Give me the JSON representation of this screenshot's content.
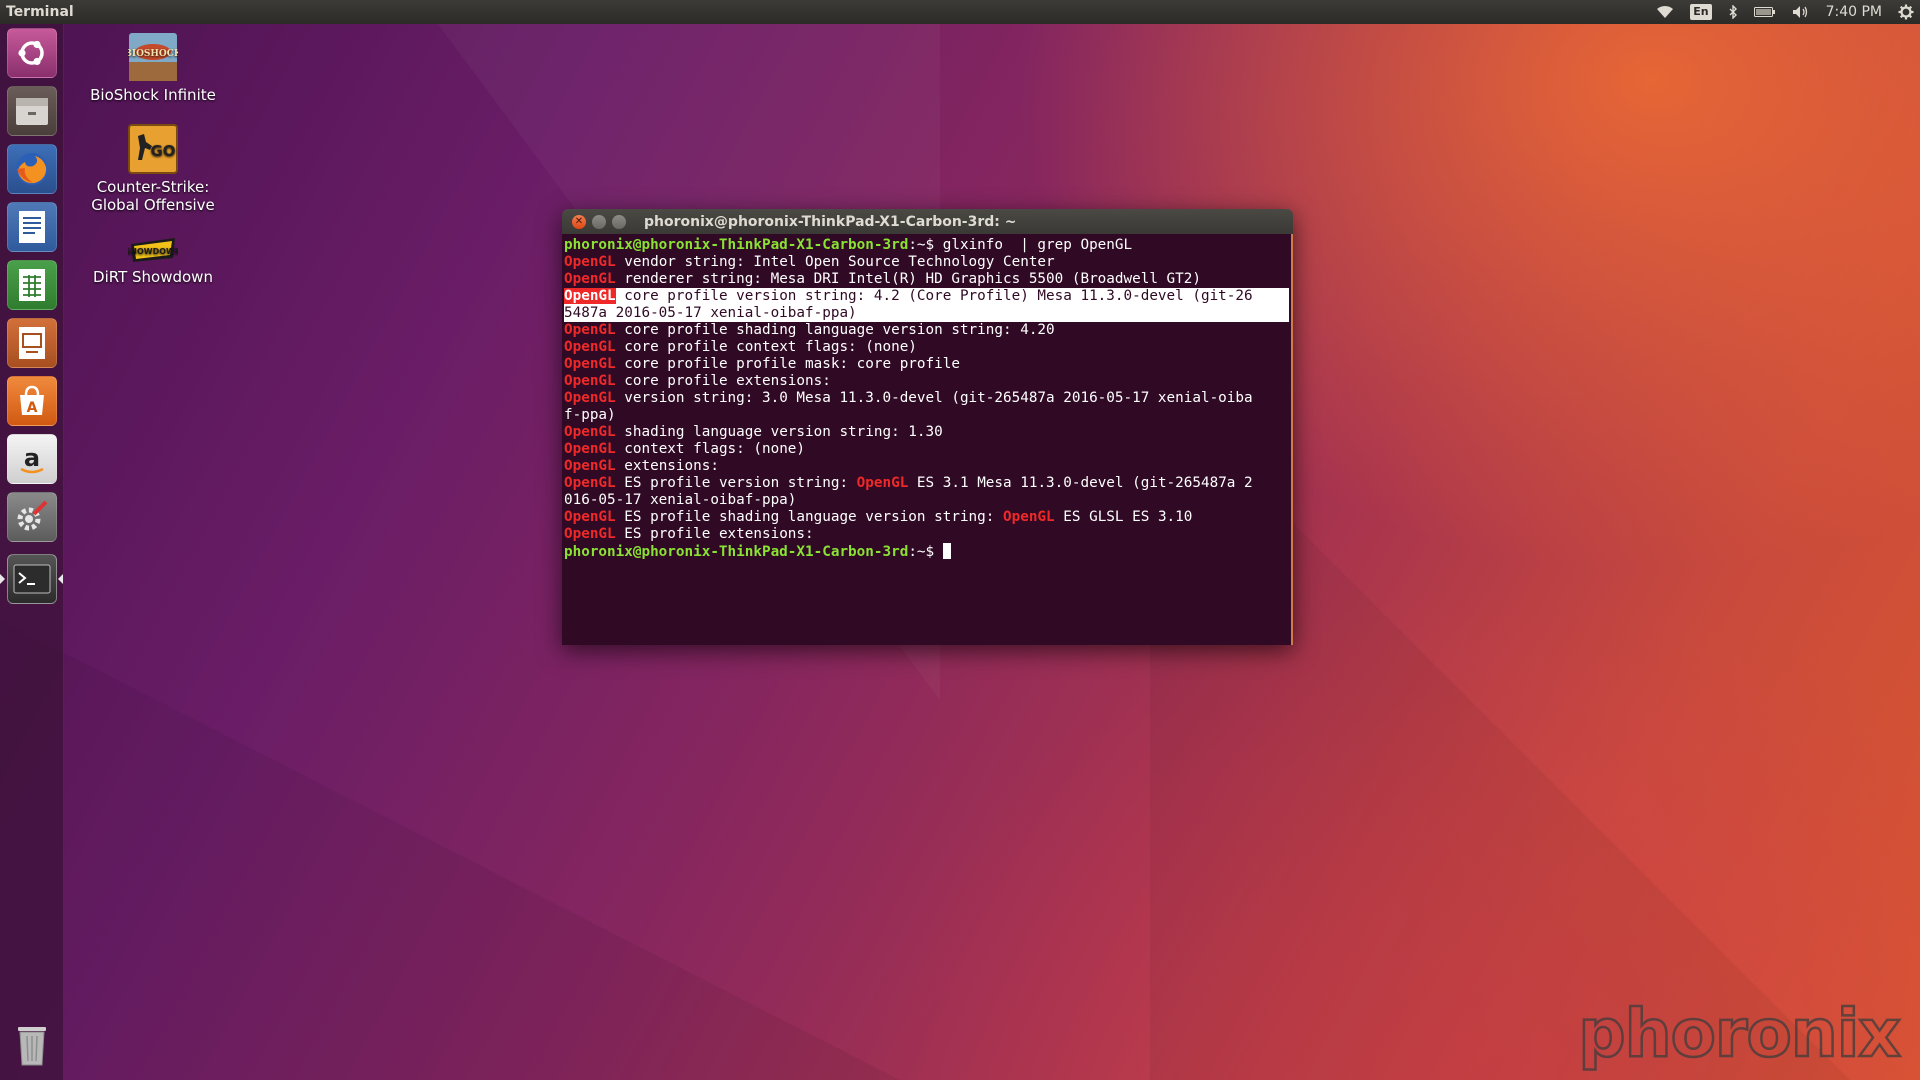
{
  "top_panel": {
    "app_title": "Terminal",
    "keyboard_layout": "En",
    "clock": "7:40 PM",
    "icons": [
      "wifi-icon",
      "keyboard-layout-indicator",
      "bluetooth-icon",
      "battery-icon",
      "volume-icon",
      "gear-icon"
    ]
  },
  "launcher": {
    "items": [
      {
        "name": "ubuntu-dash-icon"
      },
      {
        "name": "files-icon"
      },
      {
        "name": "firefox-icon"
      },
      {
        "name": "libreoffice-writer-icon"
      },
      {
        "name": "libreoffice-calc-icon"
      },
      {
        "name": "libreoffice-impress-icon"
      },
      {
        "name": "ubuntu-software-icon"
      },
      {
        "name": "amazon-icon"
      },
      {
        "name": "system-settings-icon"
      },
      {
        "name": "terminal-icon"
      },
      {
        "name": "trash-icon"
      }
    ],
    "active": "terminal-icon"
  },
  "desktop": {
    "icons": [
      {
        "label": "BioShock Infinite",
        "icon": "bioshock-icon"
      },
      {
        "label_1": "Counter-Strike:",
        "label_2": "Global Offensive",
        "icon": "csgo-icon"
      },
      {
        "label": "DiRT Showdown",
        "icon": "dirt-showdown-icon"
      }
    ]
  },
  "terminal": {
    "title": "phoronix@phoronix-ThinkPad-X1-Carbon-3rd: ~",
    "prompt": "phoronix@phoronix-ThinkPad-X1-Carbon-3rd",
    "prompt_suffix": ":~$ ",
    "command": "glxinfo  | grep OpenGL",
    "keyword": "OpenGL",
    "lines": {
      "l1": " vendor string: Intel Open Source Technology Center",
      "l2": " renderer string: Mesa DRI Intel(R) HD Graphics 5500 (Broadwell GT2)",
      "l3a": " core profile version string: 4.2 (Core Profile) Mesa 11.3.0-devel (git-26",
      "l3b": "5487a 2016-05-17 xenial-oibaf-ppa)",
      "l4": " core profile shading language version string: 4.20",
      "l5": " core profile context flags: (none)",
      "l6": " core profile profile mask: core profile",
      "l7": " core profile extensions:",
      "l8a": " version string: 3.0 Mesa 11.3.0-devel (git-265487a 2016-05-17 xenial-oiba",
      "l8b": "f-ppa)",
      "l9": " shading language version string: 1.30",
      "l10": " context flags: (none)",
      "l11": " extensions:",
      "l12a": " ES profile version string: ",
      "l12b": " ES 3.1 Mesa 11.3.0-devel (git-265487a 2",
      "l12c": "016-05-17 xenial-oibaf-ppa)",
      "l13a": " ES profile shading language version string: ",
      "l13b": " ES GLSL ES 3.10",
      "l14": " ES profile extensions:"
    }
  },
  "watermark": "phoronix",
  "colors": {
    "terminal_bg": "#300a24",
    "prompt_green": "#8ae234",
    "keyword_red": "#ef2929",
    "panel_bg": "#3c3b37"
  }
}
